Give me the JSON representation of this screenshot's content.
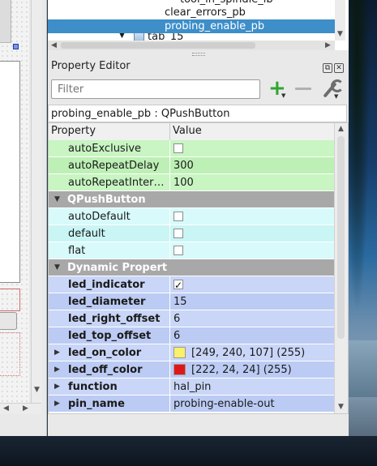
{
  "object_tree": {
    "rows": [
      {
        "label": "tool_in_spindle_lb",
        "selected": false
      },
      {
        "label": "clear_errors_pb",
        "selected": false
      },
      {
        "label": "probing_enable_pb",
        "selected": true
      },
      {
        "label": "tab_15",
        "selected": false
      }
    ]
  },
  "property_editor": {
    "title": "Property Editor",
    "filter_placeholder": "Filter",
    "class_label": "probing_enable_pb : QPushButton",
    "col_property": "Property",
    "col_value": "Value",
    "rows": [
      {
        "kind": "prop",
        "color": "green",
        "name": "autoExclusive",
        "type": "checkbox",
        "checked": false
      },
      {
        "kind": "prop",
        "color": "green",
        "name": "autoRepeatDelay",
        "type": "text",
        "value": "300"
      },
      {
        "kind": "prop",
        "color": "green",
        "name": "autoRepeatInter…",
        "type": "text",
        "value": "100"
      },
      {
        "kind": "section",
        "name": "QPushButton"
      },
      {
        "kind": "prop",
        "color": "cyan",
        "name": "autoDefault",
        "type": "checkbox",
        "checked": false
      },
      {
        "kind": "prop",
        "color": "cyan",
        "name": "default",
        "type": "checkbox",
        "checked": false
      },
      {
        "kind": "prop",
        "color": "cyan",
        "name": "flat",
        "type": "checkbox",
        "checked": false
      },
      {
        "kind": "section",
        "name": "Dynamic Properties"
      },
      {
        "kind": "prop",
        "color": "blue",
        "name": "led_indicator",
        "type": "checkbox",
        "checked": true
      },
      {
        "kind": "prop",
        "color": "blue",
        "name": "led_diameter",
        "type": "text",
        "value": "15"
      },
      {
        "kind": "prop",
        "color": "blue",
        "name": "led_right_offset",
        "type": "text",
        "value": "6"
      },
      {
        "kind": "prop",
        "color": "blue",
        "name": "led_top_offset",
        "type": "text",
        "value": "6"
      },
      {
        "kind": "prop",
        "color": "blue",
        "name": "led_on_color",
        "type": "color",
        "swatch": "#f9f06b",
        "value": "[249, 240, 107] (255)",
        "expandable": true
      },
      {
        "kind": "prop",
        "color": "blue",
        "name": "led_off_color",
        "type": "color",
        "swatch": "#de1818",
        "value": "[222, 24, 24] (255)",
        "expandable": true
      },
      {
        "kind": "prop",
        "color": "blue",
        "name": "function",
        "type": "text",
        "value": "hal_pin",
        "expandable": true
      },
      {
        "kind": "prop",
        "color": "blue",
        "name": "pin_name",
        "type": "text",
        "value": "probing-enable-out",
        "expandable": true
      }
    ]
  }
}
